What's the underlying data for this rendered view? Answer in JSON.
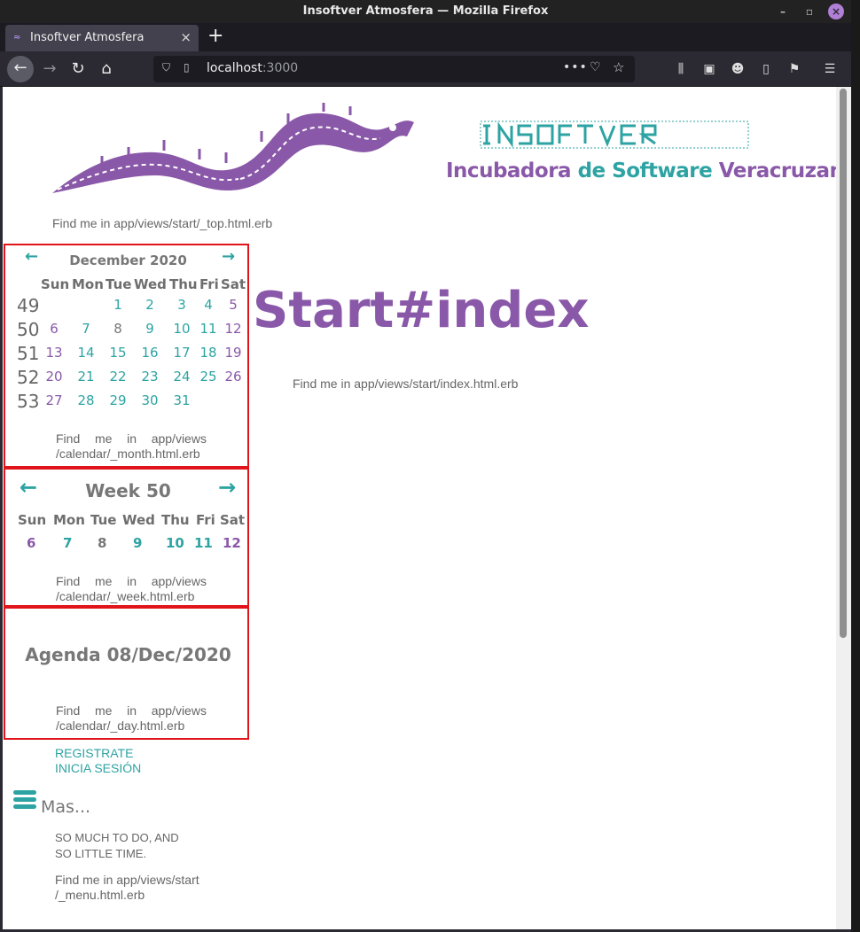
{
  "window": {
    "title": "Insoftver Atmosfera — Mozilla Firefox"
  },
  "tab": {
    "title": "Insoftver Atmosfera"
  },
  "urlbar": {
    "host": "localhost",
    "port": ":3000"
  },
  "header": {
    "tagline_a": "Incubadora ",
    "tagline_b": "de ",
    "tagline_c": "Software ",
    "tagline_d": "Veracruzana",
    "find_top": "Find me in app/views/start/_top.html.erb"
  },
  "month": {
    "title": "December 2020",
    "prev_icon": "arrow-left-icon",
    "next_icon": "arrow-right-icon",
    "weekdays": [
      "Sun",
      "Mon",
      "Tue",
      "Wed",
      "Thu",
      "Fri",
      "Sat"
    ],
    "weeks": [
      {
        "num": "49",
        "days": [
          "",
          "",
          "1",
          "2",
          "3",
          "4",
          "5"
        ]
      },
      {
        "num": "50",
        "days": [
          "6",
          "7",
          "8",
          "9",
          "10",
          "11",
          "12"
        ]
      },
      {
        "num": "51",
        "days": [
          "13",
          "14",
          "15",
          "16",
          "17",
          "18",
          "19"
        ]
      },
      {
        "num": "52",
        "days": [
          "20",
          "21",
          "22",
          "23",
          "24",
          "25",
          "26"
        ]
      },
      {
        "num": "53",
        "days": [
          "27",
          "28",
          "29",
          "30",
          "31",
          "",
          ""
        ]
      }
    ],
    "find_1": [
      "Find",
      "me",
      "in",
      "app/views"
    ],
    "find_2": "/calendar/_month.html.erb"
  },
  "week": {
    "title": "Week 50",
    "weekdays": [
      "Sun",
      "Mon",
      "Tue",
      "Wed",
      "Thu",
      "Fri",
      "Sat"
    ],
    "days": [
      "6",
      "7",
      "8",
      "9",
      "10",
      "11",
      "12"
    ],
    "find_1": [
      "Find",
      "me",
      "in",
      "app/views"
    ],
    "find_2": "/calendar/_week.html.erb"
  },
  "day": {
    "title": "Agenda 08/Dec/2020",
    "find_1": [
      "Find",
      "me",
      "in",
      "app/views"
    ],
    "find_2": "/calendar/_day.html.erb"
  },
  "menu": {
    "register": "REGISTRATE",
    "login": "INICIA SESIÓN",
    "more": "Mas...",
    "motto_1": "SO MUCH TO DO, AND",
    "motto_2": "SO LITTLE TIME.",
    "find_1": "Find me in app/views/start",
    "find_2": "/_menu.html.erb"
  },
  "main": {
    "title": "Start#index",
    "find": "Find me in app/views/start/index.html.erb"
  },
  "colors": {
    "purple": "#8a58a8",
    "teal": "#2ea3a3",
    "highlight": "#e0141a"
  }
}
